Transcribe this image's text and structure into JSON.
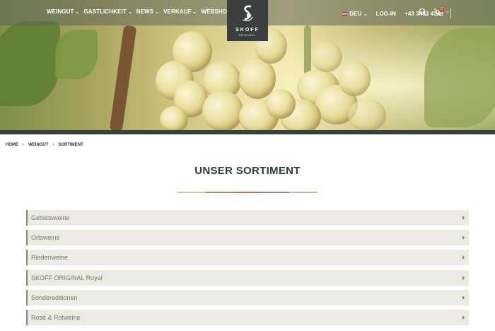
{
  "nav": {
    "left_items": [
      {
        "label": "WEINGUT",
        "has_dropdown": true
      },
      {
        "label": "GASTLICHKEIT",
        "has_dropdown": true
      },
      {
        "label": "NEWS",
        "has_dropdown": true
      },
      {
        "label": "VERKAUF",
        "has_dropdown": true
      },
      {
        "label": "WEBSHOP",
        "has_dropdown": false
      }
    ],
    "language": "DEU",
    "login": "LOG-IN",
    "phone": "+43 3453 4243",
    "cart_count": "0",
    "icons": [
      "search-icon",
      "cart-icon",
      "chevron-down-icon"
    ]
  },
  "logo": {
    "name": "SKOFF",
    "sub": "ORIGINAL"
  },
  "breadcrumb": [
    "HOME",
    "WEINGUT",
    "SORTIMENT"
  ],
  "page": {
    "title": "UNSER SORTIMENT"
  },
  "accordion": [
    {
      "label": "Gebietsweine"
    },
    {
      "label": "Ortsweine"
    },
    {
      "label": "Riedenweine"
    },
    {
      "label": "SKOFF ORIGINAL Royal"
    },
    {
      "label": "Sondereditionen"
    },
    {
      "label": "Rosé & Rotweine"
    }
  ],
  "colors": {
    "accent_dark": "#3b3f3d",
    "title": "#2f3a34",
    "accordion_bg": "#ecebe3",
    "accordion_text": "#6f7f6b",
    "rule": [
      "#c9c3b3",
      "#a6906b",
      "#b9765c",
      "#8e8da0",
      "#b9b6a5"
    ]
  }
}
